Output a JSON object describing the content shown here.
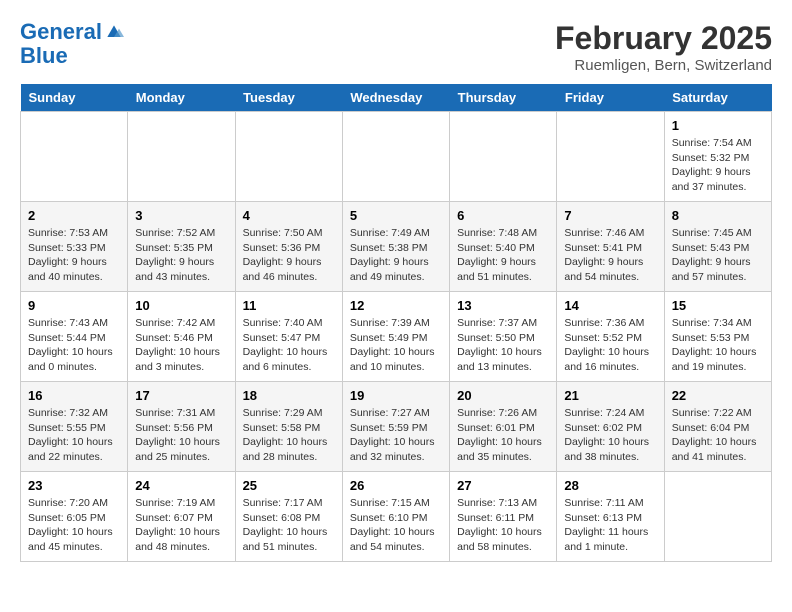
{
  "logo": {
    "line1": "General",
    "line2": "Blue"
  },
  "title": "February 2025",
  "subtitle": "Ruemligen, Bern, Switzerland",
  "headers": [
    "Sunday",
    "Monday",
    "Tuesday",
    "Wednesday",
    "Thursday",
    "Friday",
    "Saturday"
  ],
  "weeks": [
    [
      {
        "day": "",
        "info": ""
      },
      {
        "day": "",
        "info": ""
      },
      {
        "day": "",
        "info": ""
      },
      {
        "day": "",
        "info": ""
      },
      {
        "day": "",
        "info": ""
      },
      {
        "day": "",
        "info": ""
      },
      {
        "day": "1",
        "info": "Sunrise: 7:54 AM\nSunset: 5:32 PM\nDaylight: 9 hours and 37 minutes."
      }
    ],
    [
      {
        "day": "2",
        "info": "Sunrise: 7:53 AM\nSunset: 5:33 PM\nDaylight: 9 hours and 40 minutes."
      },
      {
        "day": "3",
        "info": "Sunrise: 7:52 AM\nSunset: 5:35 PM\nDaylight: 9 hours and 43 minutes."
      },
      {
        "day": "4",
        "info": "Sunrise: 7:50 AM\nSunset: 5:36 PM\nDaylight: 9 hours and 46 minutes."
      },
      {
        "day": "5",
        "info": "Sunrise: 7:49 AM\nSunset: 5:38 PM\nDaylight: 9 hours and 49 minutes."
      },
      {
        "day": "6",
        "info": "Sunrise: 7:48 AM\nSunset: 5:40 PM\nDaylight: 9 hours and 51 minutes."
      },
      {
        "day": "7",
        "info": "Sunrise: 7:46 AM\nSunset: 5:41 PM\nDaylight: 9 hours and 54 minutes."
      },
      {
        "day": "8",
        "info": "Sunrise: 7:45 AM\nSunset: 5:43 PM\nDaylight: 9 hours and 57 minutes."
      }
    ],
    [
      {
        "day": "9",
        "info": "Sunrise: 7:43 AM\nSunset: 5:44 PM\nDaylight: 10 hours and 0 minutes."
      },
      {
        "day": "10",
        "info": "Sunrise: 7:42 AM\nSunset: 5:46 PM\nDaylight: 10 hours and 3 minutes."
      },
      {
        "day": "11",
        "info": "Sunrise: 7:40 AM\nSunset: 5:47 PM\nDaylight: 10 hours and 6 minutes."
      },
      {
        "day": "12",
        "info": "Sunrise: 7:39 AM\nSunset: 5:49 PM\nDaylight: 10 hours and 10 minutes."
      },
      {
        "day": "13",
        "info": "Sunrise: 7:37 AM\nSunset: 5:50 PM\nDaylight: 10 hours and 13 minutes."
      },
      {
        "day": "14",
        "info": "Sunrise: 7:36 AM\nSunset: 5:52 PM\nDaylight: 10 hours and 16 minutes."
      },
      {
        "day": "15",
        "info": "Sunrise: 7:34 AM\nSunset: 5:53 PM\nDaylight: 10 hours and 19 minutes."
      }
    ],
    [
      {
        "day": "16",
        "info": "Sunrise: 7:32 AM\nSunset: 5:55 PM\nDaylight: 10 hours and 22 minutes."
      },
      {
        "day": "17",
        "info": "Sunrise: 7:31 AM\nSunset: 5:56 PM\nDaylight: 10 hours and 25 minutes."
      },
      {
        "day": "18",
        "info": "Sunrise: 7:29 AM\nSunset: 5:58 PM\nDaylight: 10 hours and 28 minutes."
      },
      {
        "day": "19",
        "info": "Sunrise: 7:27 AM\nSunset: 5:59 PM\nDaylight: 10 hours and 32 minutes."
      },
      {
        "day": "20",
        "info": "Sunrise: 7:26 AM\nSunset: 6:01 PM\nDaylight: 10 hours and 35 minutes."
      },
      {
        "day": "21",
        "info": "Sunrise: 7:24 AM\nSunset: 6:02 PM\nDaylight: 10 hours and 38 minutes."
      },
      {
        "day": "22",
        "info": "Sunrise: 7:22 AM\nSunset: 6:04 PM\nDaylight: 10 hours and 41 minutes."
      }
    ],
    [
      {
        "day": "23",
        "info": "Sunrise: 7:20 AM\nSunset: 6:05 PM\nDaylight: 10 hours and 45 minutes."
      },
      {
        "day": "24",
        "info": "Sunrise: 7:19 AM\nSunset: 6:07 PM\nDaylight: 10 hours and 48 minutes."
      },
      {
        "day": "25",
        "info": "Sunrise: 7:17 AM\nSunset: 6:08 PM\nDaylight: 10 hours and 51 minutes."
      },
      {
        "day": "26",
        "info": "Sunrise: 7:15 AM\nSunset: 6:10 PM\nDaylight: 10 hours and 54 minutes."
      },
      {
        "day": "27",
        "info": "Sunrise: 7:13 AM\nSunset: 6:11 PM\nDaylight: 10 hours and 58 minutes."
      },
      {
        "day": "28",
        "info": "Sunrise: 7:11 AM\nSunset: 6:13 PM\nDaylight: 11 hours and 1 minute."
      },
      {
        "day": "",
        "info": ""
      }
    ]
  ]
}
